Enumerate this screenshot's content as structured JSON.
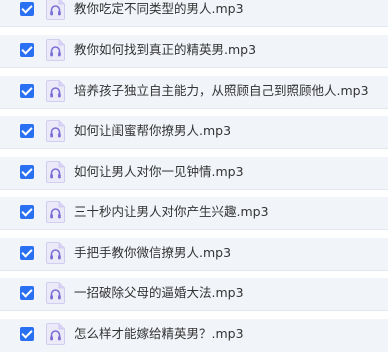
{
  "file_list": {
    "items": [
      {
        "name": "教你吃定不同类型的男人.mp3",
        "checked": true,
        "icon": "audio-file-icon"
      },
      {
        "name": "教你如何找到真正的精英男.mp3",
        "checked": true,
        "icon": "audio-file-icon"
      },
      {
        "name": "培养孩子独立自主能力，从照顾自己到照顾他人.mp3",
        "checked": true,
        "icon": "audio-file-icon"
      },
      {
        "name": "如何让闺蜜帮你撩男人.mp3",
        "checked": true,
        "icon": "audio-file-icon"
      },
      {
        "name": "如何让男人对你一见钟情.mp3",
        "checked": true,
        "icon": "audio-file-icon"
      },
      {
        "name": "三十秒内让男人对你产生兴趣.mp3",
        "checked": true,
        "icon": "audio-file-icon"
      },
      {
        "name": "手把手教你微信撩男人.mp3",
        "checked": true,
        "icon": "audio-file-icon"
      },
      {
        "name": "一招破除父母的逼婚大法.mp3",
        "checked": true,
        "icon": "audio-file-icon"
      },
      {
        "name": "怎么样才能嫁给精英男？.mp3",
        "checked": true,
        "icon": "audio-file-icon"
      }
    ]
  },
  "colors": {
    "row_background": "#f1f4f9",
    "checkbox_fill": "#2970f2",
    "icon_fill": "#eceaf9",
    "icon_accent": "#7b6fd6",
    "text": "#333333"
  }
}
